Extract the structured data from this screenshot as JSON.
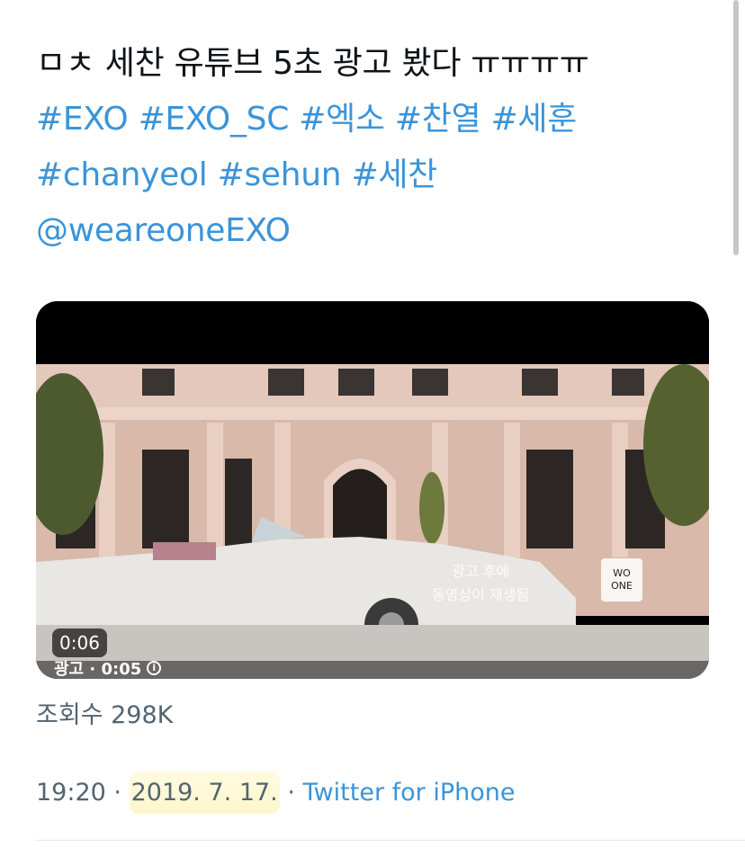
{
  "tweet": {
    "line1": "ㅁㅊ 세찬 유튜브 5초 광고 봤다 ㅠㅠㅠㅠ",
    "hashtags1": [
      "#EXO",
      "#EXO_SC",
      "#엑소",
      "#찬열",
      "#세훈"
    ],
    "hashtags2": [
      "#chanyeol",
      "#sehun",
      "#세찬"
    ],
    "mention": "@weareoneEXO"
  },
  "video": {
    "duration": "0:06",
    "ad_label": "광고 · 0:05",
    "overlay_line1": "광고 후에",
    "overlay_line2": "동영상이 재생됨",
    "badge_line1": "WO",
    "badge_line2": "ONE"
  },
  "views": "조회수 298K",
  "meta": {
    "time": "19:20",
    "separator": "·",
    "date": "2019. 7. 17.",
    "source": "Twitter for iPhone"
  },
  "colors": {
    "link": "#3b94d9",
    "text": "#0f1419",
    "secondary": "#536471",
    "highlight": "#fff6cc"
  }
}
